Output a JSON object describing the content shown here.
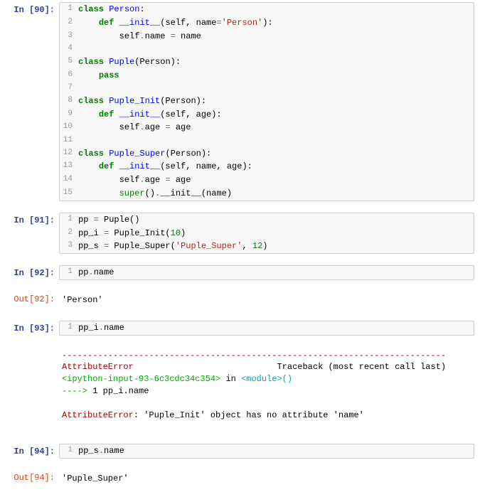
{
  "cells": [
    {
      "prompt_in": "In [90]:",
      "lines": [
        {
          "n": "1",
          "tokens": [
            [
              "kw",
              "class"
            ],
            [
              "p",
              " "
            ],
            [
              "cls",
              "Person"
            ],
            [
              "p",
              ":"
            ]
          ]
        },
        {
          "n": "2",
          "tokens": [
            [
              "p",
              "    "
            ],
            [
              "kw",
              "def"
            ],
            [
              "p",
              " "
            ],
            [
              "cls",
              "__init__"
            ],
            [
              "p",
              "("
            ],
            [
              "p",
              "self, name"
            ],
            [
              "op",
              "="
            ],
            [
              "str",
              "'Person'"
            ],
            [
              "p",
              "):"
            ]
          ]
        },
        {
          "n": "3",
          "tokens": [
            [
              "p",
              "        self"
            ],
            [
              "op",
              "."
            ],
            [
              "p",
              "name "
            ],
            [
              "op",
              "="
            ],
            [
              "p",
              " name"
            ]
          ]
        },
        {
          "n": "4",
          "tokens": [
            [
              "p",
              ""
            ]
          ]
        },
        {
          "n": "5",
          "tokens": [
            [
              "kw",
              "class"
            ],
            [
              "p",
              " "
            ],
            [
              "cls",
              "Puple"
            ],
            [
              "p",
              "(Person):"
            ]
          ]
        },
        {
          "n": "6",
          "tokens": [
            [
              "p",
              "    "
            ],
            [
              "kw",
              "pass"
            ]
          ]
        },
        {
          "n": "7",
          "tokens": [
            [
              "p",
              ""
            ]
          ]
        },
        {
          "n": "8",
          "tokens": [
            [
              "kw",
              "class"
            ],
            [
              "p",
              " "
            ],
            [
              "cls",
              "Puple_Init"
            ],
            [
              "p",
              "(Person):"
            ]
          ]
        },
        {
          "n": "9",
          "tokens": [
            [
              "p",
              "    "
            ],
            [
              "kw",
              "def"
            ],
            [
              "p",
              " "
            ],
            [
              "cls",
              "__init__"
            ],
            [
              "p",
              "(self, age):"
            ]
          ]
        },
        {
          "n": "10",
          "tokens": [
            [
              "p",
              "        self"
            ],
            [
              "op",
              "."
            ],
            [
              "p",
              "age "
            ],
            [
              "op",
              "="
            ],
            [
              "p",
              " age"
            ]
          ]
        },
        {
          "n": "11",
          "tokens": [
            [
              "p",
              ""
            ]
          ]
        },
        {
          "n": "12",
          "tokens": [
            [
              "kw",
              "class"
            ],
            [
              "p",
              " "
            ],
            [
              "cls",
              "Puple_Super"
            ],
            [
              "p",
              "(Person):"
            ]
          ]
        },
        {
          "n": "13",
          "tokens": [
            [
              "p",
              "    "
            ],
            [
              "kw",
              "def"
            ],
            [
              "p",
              " "
            ],
            [
              "cls",
              "__init__"
            ],
            [
              "p",
              "(self, name, age):"
            ]
          ]
        },
        {
          "n": "14",
          "tokens": [
            [
              "p",
              "        self"
            ],
            [
              "op",
              "."
            ],
            [
              "p",
              "age "
            ],
            [
              "op",
              "="
            ],
            [
              "p",
              " age"
            ]
          ]
        },
        {
          "n": "15",
          "tokens": [
            [
              "p",
              "        "
            ],
            [
              "builtin",
              "super"
            ],
            [
              "p",
              "()"
            ],
            [
              "op",
              "."
            ],
            [
              "p",
              "__init__(name)"
            ]
          ]
        }
      ]
    },
    {
      "prompt_in": "In [91]:",
      "lines": [
        {
          "n": "1",
          "tokens": [
            [
              "p",
              "pp "
            ],
            [
              "op",
              "="
            ],
            [
              "p",
              " Puple()"
            ]
          ]
        },
        {
          "n": "2",
          "tokens": [
            [
              "p",
              "pp_i "
            ],
            [
              "op",
              "="
            ],
            [
              "p",
              " Puple_Init("
            ],
            [
              "num",
              "10"
            ],
            [
              "p",
              ")"
            ]
          ]
        },
        {
          "n": "3",
          "tokens": [
            [
              "p",
              "pp_s "
            ],
            [
              "op",
              "="
            ],
            [
              "p",
              " Puple_Super("
            ],
            [
              "str",
              "'Puple_Super'"
            ],
            [
              "p",
              ", "
            ],
            [
              "num",
              "12"
            ],
            [
              "p",
              ")"
            ]
          ]
        }
      ]
    },
    {
      "prompt_in": "In [92]:",
      "lines": [
        {
          "n": "1",
          "tokens": [
            [
              "p",
              "pp"
            ],
            [
              "op",
              "."
            ],
            [
              "p",
              "name"
            ]
          ]
        }
      ]
    },
    {
      "prompt_out": "Out[92]:",
      "output": "'Person'"
    },
    {
      "prompt_in": "In [93]:",
      "lines": [
        {
          "n": "1",
          "tokens": [
            [
              "p",
              "pp_i"
            ],
            [
              "op",
              "."
            ],
            [
              "p",
              "name"
            ]
          ]
        }
      ]
    },
    {
      "traceback": {
        "dash": "---------------------------------------------------------------------------",
        "errname": "AttributeError",
        "header_rest": "                            Traceback (most recent call last)",
        "file": "<ipython-input-93-6c3cdc34c354>",
        "in_text": " in ",
        "func": "<module>",
        "func_tail": "()",
        "arrow": "----> ",
        "arrow_line": "1 pp_i.name",
        "final_err": "AttributeError",
        "final_msg": ": 'Puple_Init' object has no attribute 'name'"
      }
    },
    {
      "prompt_in": "In [94]:",
      "lines": [
        {
          "n": "1",
          "tokens": [
            [
              "p",
              "pp_s"
            ],
            [
              "op",
              "."
            ],
            [
              "p",
              "name"
            ]
          ]
        }
      ]
    },
    {
      "prompt_out": "Out[94]:",
      "output": "'Puple_Super'"
    }
  ]
}
